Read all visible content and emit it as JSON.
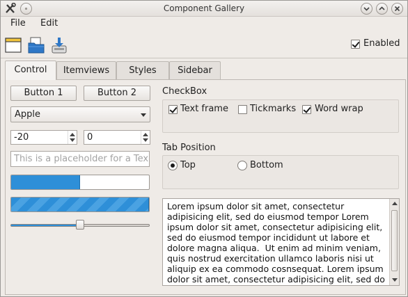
{
  "window": {
    "title": "Component Gallery"
  },
  "menubar": {
    "file": "File",
    "edit": "Edit"
  },
  "toolbar": {
    "enabled_label": "Enabled",
    "enabled_checked": true
  },
  "tabs": [
    {
      "label": "Control",
      "active": true
    },
    {
      "label": "Itemviews",
      "active": false
    },
    {
      "label": "Styles",
      "active": false
    },
    {
      "label": "Sidebar",
      "active": false
    }
  ],
  "controls": {
    "button1": "Button 1",
    "button2": "Button 2",
    "combo_value": "Apple",
    "spin1_value": "-20",
    "spin2_value": "0",
    "lineedit_placeholder": "This is a placeholder for a Tex…",
    "progress_value": 0.5,
    "slider_value": 0.5
  },
  "checkbox_group": {
    "title": "CheckBox",
    "items": [
      {
        "label": "Text frame",
        "checked": true
      },
      {
        "label": "Tickmarks",
        "checked": false
      },
      {
        "label": "Word wrap",
        "checked": true
      }
    ]
  },
  "tab_position_group": {
    "title": "Tab Position",
    "items": [
      {
        "label": "Top",
        "checked": true
      },
      {
        "label": "Bottom",
        "checked": false
      }
    ]
  },
  "textedit": {
    "text": "Lorem ipsum dolor sit amet, consectetur adipisicing elit, sed do eiusmod tempor Lorem ipsum dolor sit amet, consectetur adipisicing elit, sed do eiusmod tempor incididunt ut labore et dolore magna aliqua.  Ut enim ad minim veniam, quis nostrud exercitation ullamco laboris nisi ut aliquip ex ea commodo cosnsequat. Lorem ipsum dolor sit amet, consectetur adipisicing elit, sed do eiusmod tempor incididunt ut labore et dolore magna aliqua."
  },
  "colors": {
    "accent": "#2e8fd8",
    "window_bg": "#efebe7"
  }
}
